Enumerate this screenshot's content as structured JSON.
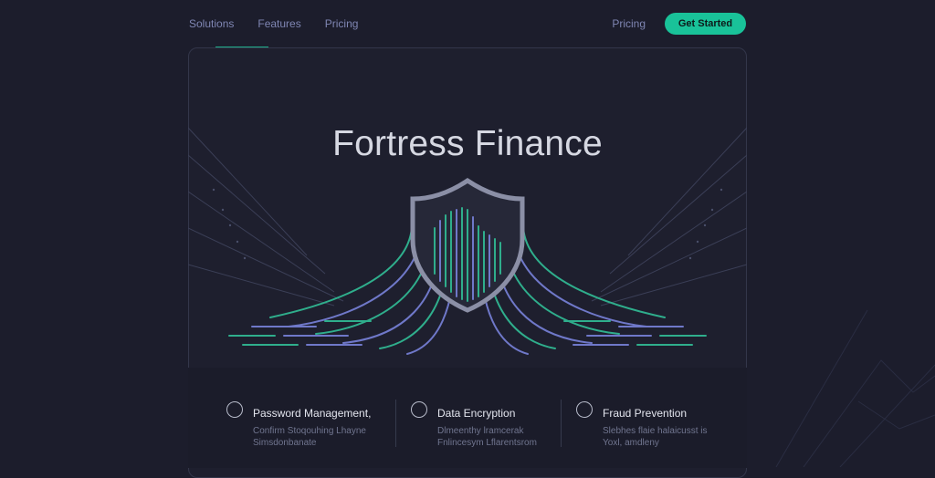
{
  "nav": {
    "left_links": [
      "Solutions",
      "Features",
      "Pricing"
    ],
    "right_link": "Pricing",
    "cta_label": "Get Started"
  },
  "hero": {
    "title": "Fortress Finance",
    "art_icon": "shield-fingerprint-icon"
  },
  "features": [
    {
      "title": "Password Management,",
      "desc": [
        "Confirm Stoqouhing Lhayne",
        "Simsdonbanate"
      ],
      "icon": "user-lock-icon"
    },
    {
      "title": "Data Encryption",
      "desc": [
        "Dlmeenthy lramcerak",
        "Fnlincesym Lflarentsrom"
      ],
      "icon": "user-lock-icon"
    },
    {
      "title": "Fraud Prevention",
      "desc": [
        "Slebhes flaie halaicusst is",
        "Yoxl, amdleny"
      ],
      "icon": "user-lock-icon"
    }
  ],
  "colors": {
    "background": "#1c1d2c",
    "accent": "#19c299",
    "nav_text": "#7f86b3",
    "line_green": "#2fae8c",
    "line_purple": "#6f78c9"
  }
}
